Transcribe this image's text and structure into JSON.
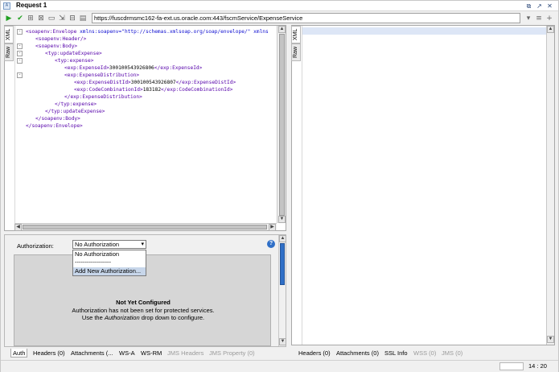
{
  "window": {
    "title": "Request 1",
    "icon_label": "A"
  },
  "toolbar": {
    "url": "https://fuscdrmsmc162-fa-ext.us.oracle.com:443/fscmService/ExpenseService"
  },
  "editor": {
    "tabs": [
      "XML",
      "Raw"
    ],
    "lines": [
      {
        "fold": "-",
        "indent": 0,
        "open": "<soapenv:Envelope ",
        "attrs": "xmlns:soapenv=\"http://schemas.xmlsoap.org/soap/envelope/\" xmlns",
        "close": ""
      },
      {
        "fold": "",
        "indent": 1,
        "open": "<soapenv:Header/>",
        "attrs": "",
        "close": ""
      },
      {
        "fold": "-",
        "indent": 1,
        "open": "<soapenv:Body>",
        "attrs": "",
        "close": ""
      },
      {
        "fold": "-",
        "indent": 2,
        "open": "<typ:updateExpense>",
        "attrs": "",
        "close": ""
      },
      {
        "fold": "-",
        "indent": 3,
        "open": "<typ:expense>",
        "attrs": "",
        "close": ""
      },
      {
        "fold": "",
        "indent": 4,
        "open": "<exp:ExpenseId>",
        "text": "300100543926806",
        "close": "</exp:ExpenseId>"
      },
      {
        "fold": "-",
        "indent": 4,
        "open": "<exp:ExpenseDistribution>",
        "attrs": "",
        "close": ""
      },
      {
        "fold": "",
        "indent": 5,
        "open": "<exp:ExpenseDistId>",
        "text": "300100543926807",
        "close": "</exp:ExpenseDistId>"
      },
      {
        "fold": "",
        "indent": 5,
        "open": "<exp:CodeCombinationId>",
        "text": "183182",
        "close": "</exp:CodeCombinationId>"
      },
      {
        "fold": "",
        "indent": 4,
        "open": "</exp:ExpenseDistribution>",
        "attrs": "",
        "close": ""
      },
      {
        "fold": "",
        "indent": 3,
        "open": "</typ:expense>",
        "attrs": "",
        "close": ""
      },
      {
        "fold": "",
        "indent": 2,
        "open": "</typ:updateExpense>",
        "attrs": "",
        "close": ""
      },
      {
        "fold": "",
        "indent": 1,
        "open": "</soapenv:Body>",
        "attrs": "",
        "close": ""
      },
      {
        "fold": "",
        "indent": 0,
        "open": "</soapenv:Envelope>",
        "attrs": "",
        "close": ""
      }
    ]
  },
  "right_editor": {
    "tabs": [
      "XML",
      "Raw"
    ]
  },
  "auth": {
    "label": "Authorization:",
    "selected": "No Authorization",
    "options": [
      "No Authorization",
      "------------------",
      "Add New Authorization..."
    ],
    "help_label": "?",
    "not_configured_title": "Not Yet Configured",
    "not_configured_line1": "Authorization has not been set for protected services.",
    "not_configured_line2_pre": "Use the ",
    "not_configured_line2_em": "Authorization",
    "not_configured_line2_post": " drop down to configure."
  },
  "left_tabs": [
    {
      "label": "Auth",
      "state": "active"
    },
    {
      "label": "Headers (0)",
      "state": "normal"
    },
    {
      "label": "Attachments (...",
      "state": "normal"
    },
    {
      "label": "WS-A",
      "state": "normal"
    },
    {
      "label": "WS-RM",
      "state": "normal"
    },
    {
      "label": "JMS Headers",
      "state": "disabled"
    },
    {
      "label": "JMS Property (0)",
      "state": "disabled"
    }
  ],
  "right_tabs": [
    {
      "label": "Headers (0)",
      "state": "normal"
    },
    {
      "label": "Attachments (0)",
      "state": "normal"
    },
    {
      "label": "SSL Info",
      "state": "normal"
    },
    {
      "label": "WSS (0)",
      "state": "disabled"
    },
    {
      "label": "JMS (0)",
      "state": "disabled"
    }
  ],
  "status": {
    "position": "14 : 20"
  },
  "icons": {
    "run": "play-icon",
    "validate": "check-icon",
    "stop": "stop-icon"
  }
}
